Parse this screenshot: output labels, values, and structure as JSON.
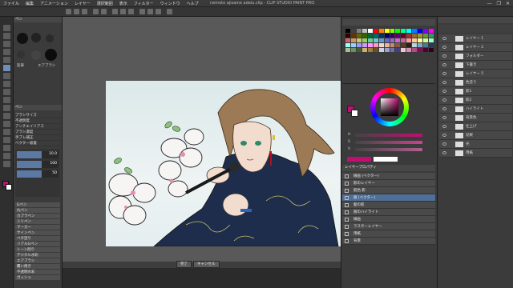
{
  "window": {
    "title": "nemoto ajisaine adalu.clip - CLIP STUDIO PAINT PRO",
    "menu": [
      "ファイル",
      "編集",
      "アニメーション",
      "レイヤー",
      "選択範囲",
      "表示",
      "フィルター",
      "ウィンドウ",
      "ヘルプ"
    ],
    "buttons": [
      "—",
      "❐",
      "✕"
    ]
  },
  "left_panel": {
    "sub_tool_title": "ペン",
    "brush_labels": [
      "鉛筆",
      "エアブラシ"
    ],
    "property_title": "ペン",
    "property_rows": [
      "ブラシサイズ",
      "不透明度",
      "アンチエイリアス",
      "ブラシ濃度",
      "手ブレ補正",
      "ベクター吸着"
    ],
    "value_rows": [
      "10.0",
      "100",
      "50"
    ],
    "subtool_list": [
      "Gペン",
      "丸ペン",
      "カブラペン",
      "ミリペン",
      "マーカー",
      "サインペン",
      "ベタ塗り",
      "リアルGペン",
      "トーン削り",
      "デジタル水彩",
      "エアブラシ",
      "覆い焼き",
      "不透明水彩",
      "ガッシュ"
    ]
  },
  "canvas": {
    "bottom_buttons": [
      "完了",
      "キャンセル"
    ]
  },
  "color_panel": {
    "swatches": [
      "#000000",
      "#404040",
      "#7f7f7f",
      "#bfbfbf",
      "#ffffff",
      "#ff0000",
      "#ff8000",
      "#ffff00",
      "#80ff00",
      "#00ff00",
      "#00ff80",
      "#00ffff",
      "#0080ff",
      "#0000ff",
      "#8000ff",
      "#ff00ff",
      "#330000",
      "#663300",
      "#666600",
      "#336600",
      "#006633",
      "#006666",
      "#003366",
      "#000066",
      "#330066",
      "#660066",
      "#660033",
      "#993333",
      "#996633",
      "#999933",
      "#669933",
      "#339966",
      "#cc6666",
      "#cc9966",
      "#cccc66",
      "#99cc66",
      "#66cc99",
      "#66cccc",
      "#6699cc",
      "#6666cc",
      "#9966cc",
      "#cc66cc",
      "#cc6699",
      "#ff9999",
      "#ffcc99",
      "#ffff99",
      "#ccff99",
      "#99ffcc",
      "#99ffff",
      "#99ccff",
      "#9999ff",
      "#cc99ff",
      "#ff99ff",
      "#ff99cc",
      "#f4d7c2",
      "#e6b99a",
      "#c98a6a",
      "#8a5a3c",
      "#5a3a2a",
      "#2b1d16",
      "#b8d6e0",
      "#7fa9c0",
      "#4a7a98",
      "#1f3e5a",
      "#a0c090",
      "#6f9060",
      "#3f6030",
      "#d0b070",
      "#a08040",
      "#705020",
      "#d0d0e8",
      "#a0a0d0",
      "#7070b0",
      "#404080",
      "#e8c8d8",
      "#d090b0",
      "#b05080",
      "#801050",
      "#500030",
      "#300020"
    ],
    "fg_color": "#c20e73",
    "bg_color": "#ffffff",
    "slider_colors": [
      "#c20e73",
      "#d04090",
      "#b06090"
    ],
    "slider_labels": [
      "H",
      "S",
      "V"
    ]
  },
  "layer_panel": {
    "title": "レイヤープロパティ",
    "rows": [
      "線画 (ベクター)",
      "影のレイヤー",
      "肌色 影",
      "服 (ベクター)",
      "髪の影",
      "服のハイライト",
      "線画",
      "ラスターレイヤー",
      "用紙",
      "背景"
    ],
    "selected_index": 3
  },
  "right_panel": {
    "rows": [
      "レイヤー 1",
      "レイヤー 2",
      "フォルダー",
      "下書き",
      "レイヤー 5",
      "色塗り",
      "影1",
      "影2",
      "ハイライト",
      "背景色",
      "仕上げ",
      "効果",
      "光",
      "用紙"
    ]
  }
}
